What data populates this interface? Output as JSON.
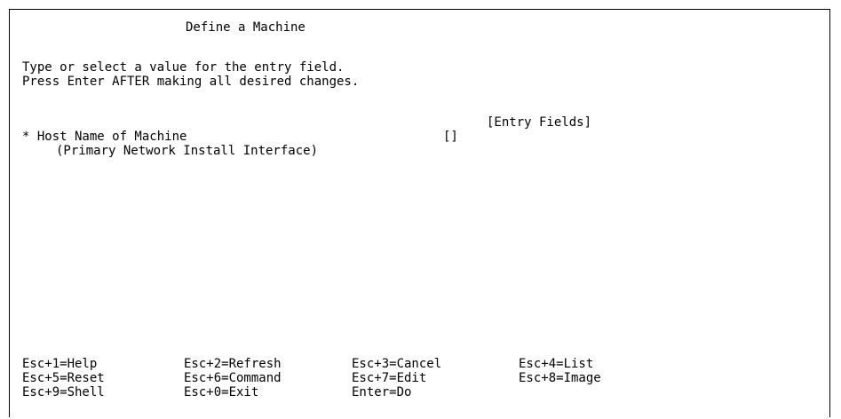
{
  "screen": {
    "title": "Define a Machine",
    "instructions": [
      "Type or select a value for the entry field.",
      "Press Enter AFTER making all desired changes."
    ],
    "entry_fields_header": "[Entry Fields]",
    "fields": [
      {
        "label": "* Host Name of Machine",
        "sublabel": "(Primary Network Install Interface)",
        "value": "[]"
      }
    ]
  },
  "function_keys": [
    [
      "Esc+1=Help",
      "Esc+2=Refresh",
      "Esc+3=Cancel",
      "Esc+4=List"
    ],
    [
      "Esc+5=Reset",
      "Esc+6=Command",
      "Esc+7=Edit",
      "Esc+8=Image"
    ],
    [
      "Esc+9=Shell",
      "Esc+0=Exit",
      "Enter=Do"
    ]
  ]
}
